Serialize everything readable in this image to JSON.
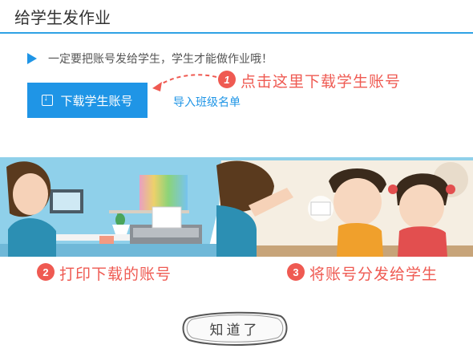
{
  "header": {
    "title": "给学生发作业"
  },
  "tip": {
    "text": "一定要把账号发给学生，学生才能做作业哦！"
  },
  "actions": {
    "download_label": "下载学生账号",
    "import_label": "导入班级名单"
  },
  "hint": {
    "badge": "1",
    "text": "点击这里下载学生账号"
  },
  "steps": [
    {
      "badge": "2",
      "text": "打印下载的账号"
    },
    {
      "badge": "3",
      "text": "将账号分发给学生"
    }
  ],
  "confirm": {
    "label": "知道了"
  },
  "colors": {
    "accent": "#1f95e6",
    "hint_red": "#ef5a52"
  }
}
